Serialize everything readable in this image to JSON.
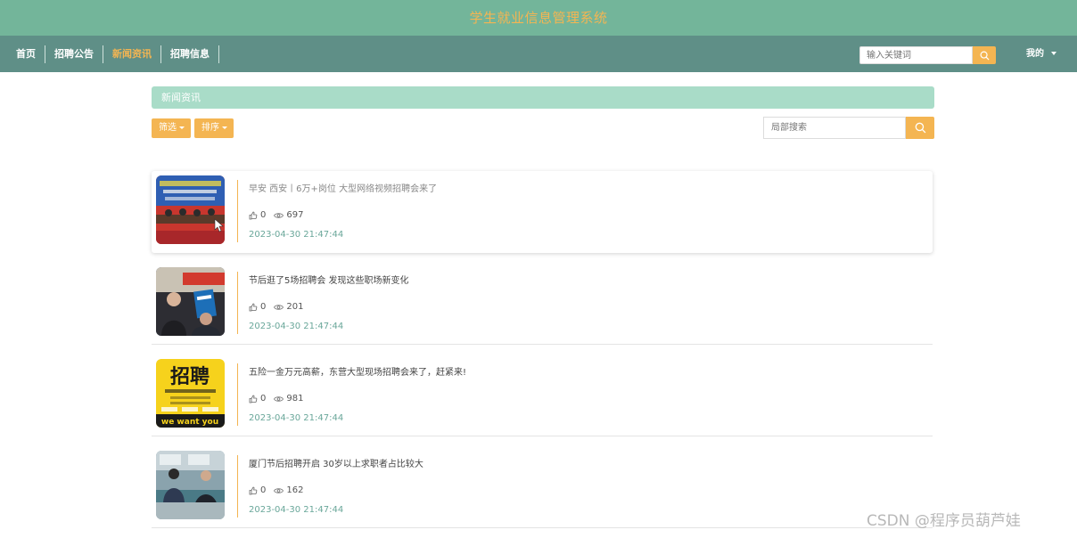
{
  "header": {
    "title": "学生就业信息管理系统"
  },
  "nav": {
    "items": [
      {
        "label": "首页",
        "active": false
      },
      {
        "label": "招聘公告",
        "active": false
      },
      {
        "label": "新闻资讯",
        "active": true
      },
      {
        "label": "招聘信息",
        "active": false
      }
    ],
    "search_placeholder": "输入关键词",
    "user_label": "我的"
  },
  "section": {
    "title": "新闻资讯"
  },
  "toolbar": {
    "filter_label": "筛选",
    "sort_label": "排序",
    "search_placeholder": "局部搜索"
  },
  "news": [
    {
      "title": "早安 西安丨6万+岗位 大型网络视频招聘会来了",
      "likes": "0",
      "views": "697",
      "date": "2023-04-30 21:47:44",
      "thumb": "conference-stage-photo"
    },
    {
      "title": "节后逛了5场招聘会 发现这些职场新变化",
      "likes": "0",
      "views": "201",
      "date": "2023-04-30 21:47:44",
      "thumb": "job-fair-crowd-photo"
    },
    {
      "title": "五险一金万元高薪，东营大型现场招聘会来了，赶紧来!",
      "likes": "0",
      "views": "981",
      "date": "2023-04-30 21:47:44",
      "thumb": "recruitment-poster-yellow"
    },
    {
      "title": "厦门节后招聘开启 30岁以上求职者占比较大",
      "likes": "0",
      "views": "162",
      "date": "2023-04-30 21:47:44",
      "thumb": "interview-desk-photo"
    }
  ],
  "thumb_texts": {
    "poster_big": "招聘",
    "poster_tag": "we want you"
  },
  "watermark": "CSDN @程序员葫芦娃",
  "colors": {
    "header_bg": "#73b59a",
    "nav_bg": "#5f8f87",
    "accent": "#f4b552",
    "section_bg": "#a9dcc8",
    "date_text": "#6aa79a"
  }
}
